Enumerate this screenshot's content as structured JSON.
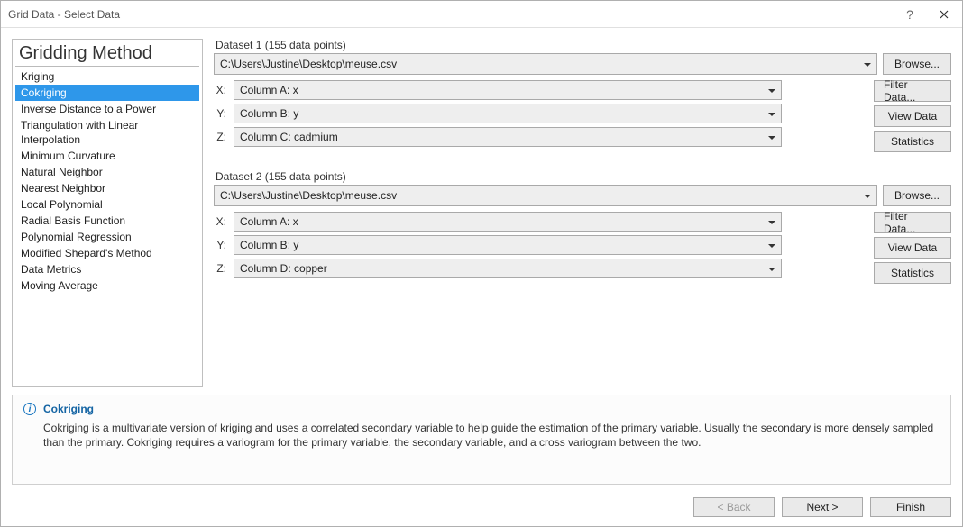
{
  "window": {
    "title": "Grid Data - Select Data"
  },
  "sidebar": {
    "title": "Gridding Method",
    "methods": [
      "Kriging",
      "Cokriging",
      "Inverse Distance to a Power",
      "Triangulation with Linear Interpolation",
      "Minimum Curvature",
      "Natural Neighbor",
      "Nearest Neighbor",
      "Local Polynomial",
      "Radial Basis Function",
      "Polynomial Regression",
      "Modified Shepard's Method",
      "Data Metrics",
      "Moving Average"
    ],
    "selected_index": 1
  },
  "labels": {
    "browse": "Browse...",
    "filter_data": "Filter Data...",
    "view_data": "View Data",
    "statistics": "Statistics",
    "x": "X:",
    "y": "Y:",
    "z": "Z:"
  },
  "datasets": [
    {
      "label": "Dataset 1   (155 data points)",
      "path": "C:\\Users\\Justine\\Desktop\\meuse.csv",
      "x": "Column A:  x",
      "y": "Column B:  y",
      "z": "Column C:  cadmium"
    },
    {
      "label": "Dataset 2   (155 data points)",
      "path": "C:\\Users\\Justine\\Desktop\\meuse.csv",
      "x": "Column A:  x",
      "y": "Column B:  y",
      "z": "Column D:  copper"
    }
  ],
  "info": {
    "title": "Cokriging",
    "body": "Cokriging is a multivariate version of kriging and uses a correlated secondary variable to help guide the estimation of the primary variable.  Usually the secondary is more densely sampled than the primary.  Cokriging requires a variogram for the primary variable, the secondary variable, and a cross variogram between the two."
  },
  "footer": {
    "back": "< Back",
    "next": "Next >",
    "finish": "Finish"
  }
}
